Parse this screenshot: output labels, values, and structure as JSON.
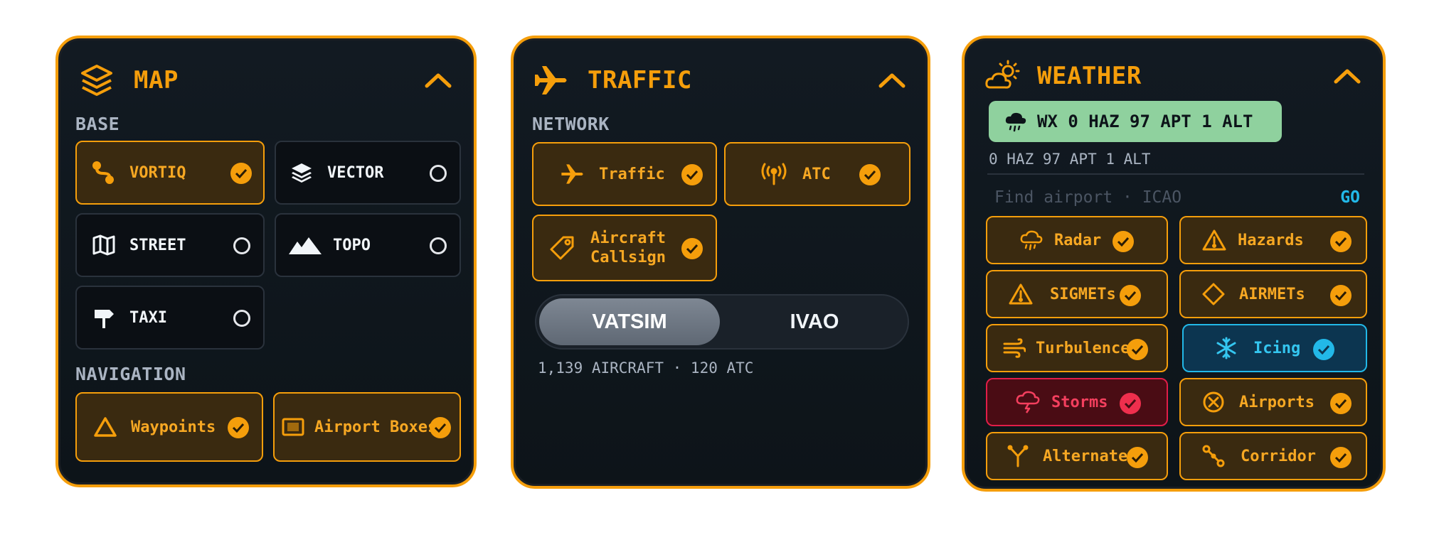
{
  "map_panel": {
    "title": "MAP",
    "base_label": "BASE",
    "base_options": [
      {
        "label": "VORTIQ",
        "icon": "route-icon",
        "selected": true
      },
      {
        "label": "VECTOR",
        "icon": "layers-icon",
        "selected": false
      },
      {
        "label": "STREET",
        "icon": "map-icon",
        "selected": false
      },
      {
        "label": "TOPO",
        "icon": "mountain-icon",
        "selected": false
      },
      {
        "label": "TAXI",
        "icon": "signpost-icon",
        "selected": false
      }
    ],
    "navigation_label": "NAVIGATION",
    "navigation_options": [
      {
        "label": "Waypoints",
        "icon": "triangle-icon",
        "checked": true
      },
      {
        "label": "Airport Boxes",
        "icon": "box-icon",
        "checked": true
      }
    ]
  },
  "traffic_panel": {
    "title": "TRAFFIC",
    "network_label": "NETWORK",
    "options": [
      {
        "label": "Traffic",
        "icon": "plane-icon",
        "checked": true
      },
      {
        "label": "ATC",
        "icon": "antenna-icon",
        "checked": true
      },
      {
        "label_line1": "Aircraft",
        "label_line2": "Callsign",
        "icon": "tag-icon",
        "checked": true
      }
    ],
    "network_toggle": {
      "options": [
        "VATSIM",
        "IVAO"
      ],
      "selected": "VATSIM"
    },
    "stats": "1,139 AIRCRAFT · 120 ATC"
  },
  "weather_panel": {
    "title": "WEATHER",
    "wx_badge": "WX 0 HAZ 97 APT 1 ALT",
    "wx_summary": "0 HAZ 97 APT 1 ALT",
    "search": {
      "placeholder": "Find airport · ICAO",
      "button": "GO"
    },
    "layers": [
      {
        "label": "Radar",
        "icon": "rain-cloud-icon",
        "state": "on"
      },
      {
        "label": "Hazards",
        "icon": "warning-icon",
        "state": "on"
      },
      {
        "label": "SIGMETs",
        "icon": "warning-icon",
        "state": "on"
      },
      {
        "label": "AIRMETs",
        "icon": "diamond-icon",
        "state": "on"
      },
      {
        "label": "Turbulence",
        "icon": "wind-icon",
        "state": "on"
      },
      {
        "label": "Icing",
        "icon": "snowflake-icon",
        "state": "cyan"
      },
      {
        "label": "Storms",
        "icon": "storm-cloud-icon",
        "state": "red"
      },
      {
        "label": "Airports",
        "icon": "airport-icon",
        "state": "on"
      },
      {
        "label": "Alternates",
        "icon": "fork-icon",
        "state": "on"
      },
      {
        "label": "Corridor",
        "icon": "route-icon",
        "state": "on"
      }
    ]
  },
  "colors": {
    "accent": "#f59e0b",
    "cyan": "#22b8e8",
    "red": "#e11d48",
    "green_badge": "#8fd19e",
    "panel_bg": "#0d1419"
  }
}
